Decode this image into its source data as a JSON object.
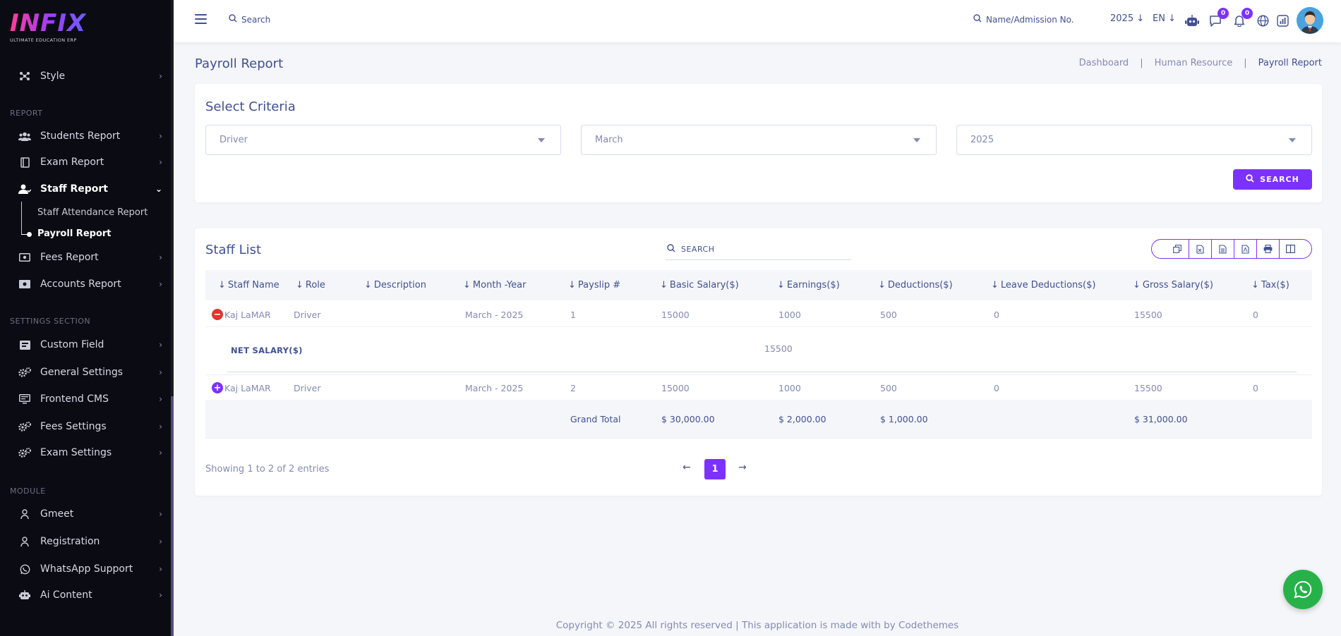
{
  "app": {
    "logo_text": "INFIX",
    "logo_sub": "ULTIMATE EDUCATION ERP"
  },
  "sidebar": {
    "top_item": {
      "label": "Style"
    },
    "report_section": "REPORT",
    "report_items": [
      {
        "label": "Students Report",
        "icon": "users-icon"
      },
      {
        "label": "Exam Report",
        "icon": "book-icon"
      },
      {
        "label": "Staff Report",
        "icon": "user-icon"
      }
    ],
    "staff_sub": [
      {
        "label": "Staff Attendance Report"
      },
      {
        "label": "Payroll Report"
      }
    ],
    "report_items_2": [
      {
        "label": "Fees Report",
        "icon": "money-icon"
      },
      {
        "label": "Accounts Report",
        "icon": "money-icon"
      }
    ],
    "settings_section": "SETTINGS SECTION",
    "settings_items": [
      {
        "label": "Custom Field"
      },
      {
        "label": "General Settings"
      },
      {
        "label": "Frontend CMS"
      },
      {
        "label": "Fees Settings"
      },
      {
        "label": "Exam Settings"
      }
    ],
    "module_section": "MODULE",
    "module_items": [
      {
        "label": "Gmeet"
      },
      {
        "label": "Registration"
      },
      {
        "label": "WhatsApp Support"
      },
      {
        "label": "Ai Content"
      }
    ]
  },
  "topbar": {
    "search_label": "Search",
    "admission_label": "Name/Admission No.",
    "year": "2025",
    "lang": "EN",
    "chat_badge": "0",
    "notif_badge": "0"
  },
  "page": {
    "title": "Payroll Report",
    "breadcrumb": [
      "Dashboard",
      "Human Resource",
      "Payroll Report"
    ],
    "breadcrumb_sep": "|"
  },
  "criteria": {
    "title": "Select Criteria",
    "role_value": "Driver",
    "month_value": "March",
    "year_value": "2025",
    "search_button": "SEARCH"
  },
  "staff_list": {
    "title": "Staff List",
    "search_placeholder": "SEARCH",
    "columns": [
      "Staff Name",
      "Role",
      "Description",
      "Month -Year",
      "Payslip #",
      "Basic Salary($)",
      "Earnings($)",
      "Deductions($)",
      "Leave Deductions($)",
      "Gross Salary($)",
      "Tax($)"
    ],
    "rows": [
      {
        "name": "Kaj LaMAR",
        "role": "Driver",
        "description": "",
        "month_year": "March - 2025",
        "payslip": "1",
        "basic": "15000",
        "earnings": "1000",
        "deductions": "500",
        "leave": "0",
        "gross": "15500",
        "tax": "0",
        "expanded": true
      },
      {
        "name": "Kaj LaMAR",
        "role": "Driver",
        "description": "",
        "month_year": "March - 2025",
        "payslip": "2",
        "basic": "15000",
        "earnings": "1000",
        "deductions": "500",
        "leave": "0",
        "gross": "15500",
        "tax": "0",
        "expanded": false
      }
    ],
    "net_salary_label": "NET SALARY($)",
    "net_salary_value": "15500",
    "grand_total": {
      "label": "Grand Total",
      "basic": "$ 30,000.00",
      "earnings": "$ 2,000.00",
      "deductions": "$ 1,000.00",
      "gross": "$ 31,000.00"
    },
    "showing": "Showing 1 to 2 of 2 entries",
    "page": "1"
  },
  "footer": {
    "text": "Copyright © 2025 All rights reserved | This application is made with by Codethemes"
  },
  "colors": {
    "accent": "#7c32ff",
    "text": "#415094",
    "muted": "#828bb2",
    "sidebar_bg": "#0b0b14",
    "whatsapp": "#27b249",
    "danger": "#e3342f"
  }
}
